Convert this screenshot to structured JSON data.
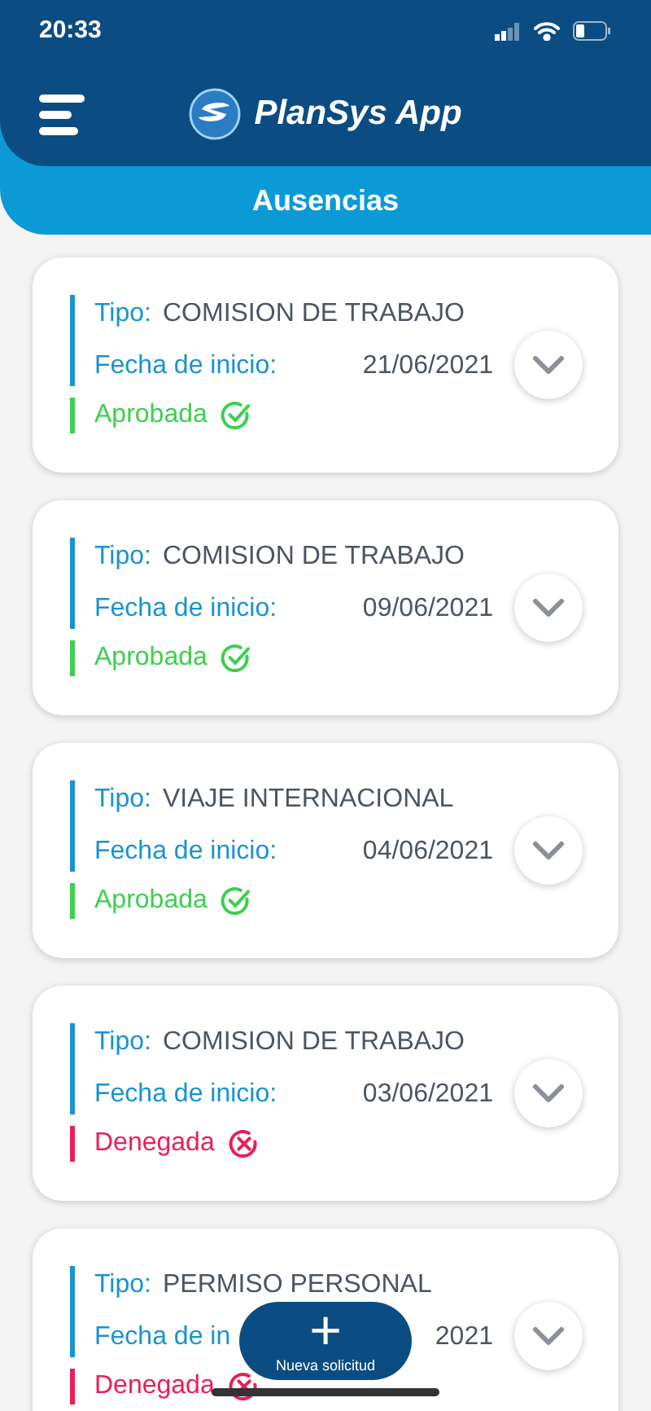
{
  "status_bar": {
    "time": "20:33"
  },
  "header": {
    "app_name": "PlanSys App",
    "section": "Ausencias"
  },
  "requests": [
    {
      "type_label": "Tipo:",
      "type": "COMISION DE TRABAJO",
      "date_label": "Fecha de inicio:",
      "date": "21/06/2021",
      "status": "Aprobada",
      "kind": "approved"
    },
    {
      "type_label": "Tipo:",
      "type": "COMISION DE TRABAJO",
      "date_label": "Fecha de inicio:",
      "date": "09/06/2021",
      "status": "Aprobada",
      "kind": "approved"
    },
    {
      "type_label": "Tipo:",
      "type": "VIAJE INTERNACIONAL",
      "date_label": "Fecha de inicio:",
      "date": "04/06/2021",
      "status": "Aprobada",
      "kind": "approved"
    },
    {
      "type_label": "Tipo:",
      "type": "COMISION DE TRABAJO",
      "date_label": "Fecha de inicio:",
      "date": "03/06/2021",
      "status": "Denegada",
      "kind": "denied"
    },
    {
      "type_label": "Tipo:",
      "type": "PERMISO PERSONAL",
      "date_label": "Fecha de in",
      "date": "2021",
      "status": "Denegada",
      "kind": "denied"
    }
  ],
  "fab": {
    "plus": "+",
    "label": "Nueva solicitud"
  }
}
